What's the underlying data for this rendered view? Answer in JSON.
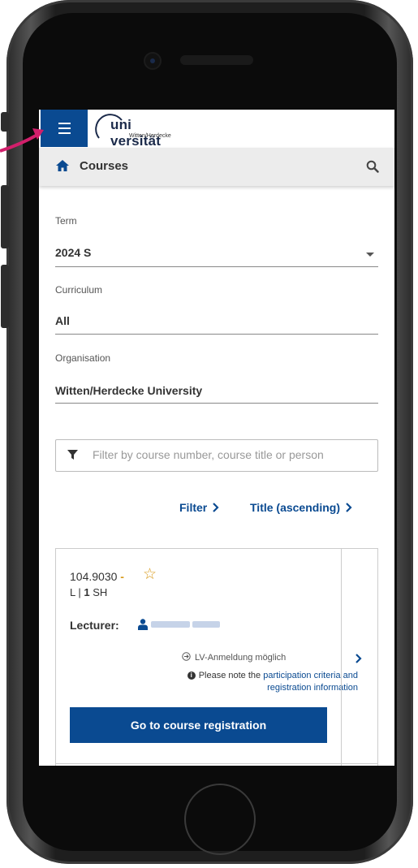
{
  "header": {
    "logo_text": "uni versität",
    "logo_subtitle": "Witten/Herdecke"
  },
  "breadcrumb": {
    "title": "Courses"
  },
  "form": {
    "term_label": "Term",
    "term_value": "2024 S",
    "curriculum_label": "Curriculum",
    "curriculum_value": "All",
    "organisation_label": "Organisation",
    "organisation_value": "Witten/Herdecke University"
  },
  "search": {
    "placeholder": "Filter by course number, course title or person"
  },
  "links": {
    "filter": "Filter",
    "sort": "Title (ascending)"
  },
  "course": {
    "number": "104.9030",
    "separator": "-",
    "type_prefix": "L | ",
    "hours": "1",
    "hours_unit": " SH",
    "lecturer_label": "Lecturer:",
    "lv_status": "LV-Anmeldung möglich",
    "note_prefix": "Please note the ",
    "note_link_1": "participation criteria and",
    "note_link_2": "registration information",
    "register_button": "Go to course registration"
  },
  "colors": {
    "brand_blue": "#0a4a91",
    "star": "#d89a1a",
    "annotation_arrow": "#d21f6b"
  },
  "icons": [
    "hamburger-menu-icon",
    "home-icon",
    "search-icon",
    "caret-down-icon",
    "filter-icon",
    "chevron-right-icon",
    "star-outline-icon",
    "person-icon",
    "arrow-circle-right-icon",
    "info-icon"
  ]
}
